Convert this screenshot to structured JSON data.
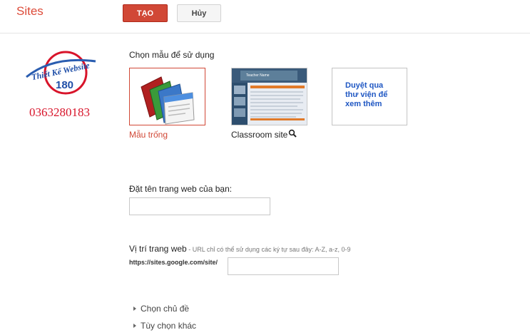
{
  "header": {
    "app_title": "Sites",
    "create_label": "TẠO",
    "cancel_label": "Hủy"
  },
  "branding": {
    "logo_text_line1": "Thiết Kế Website",
    "logo_text_line2": "180",
    "phone": "0363280183"
  },
  "templates": {
    "heading": "Chọn mẫu để sử dụng",
    "blank_label": "Mẫu trống",
    "classroom_label": "Classroom site",
    "classroom_thumb_title": "Teacher Name",
    "browse_text": "Duyệt qua thư viện để xem thêm"
  },
  "site_name": {
    "label": "Đặt tên trang web của bạn:",
    "value": ""
  },
  "site_location": {
    "label": "Vị trí trang web",
    "hint": " - URL chỉ có thể sử dụng các ký tự sau đây: A-Z, a-z, 0-9",
    "url_prefix": "https://sites.google.com/site/",
    "value": ""
  },
  "options": {
    "theme_label": "Chọn chủ đề",
    "more_label": "Tùy chọn khác"
  },
  "colors": {
    "accent": "#d14836",
    "link": "#1f57c3",
    "phone": "#d8142a"
  }
}
